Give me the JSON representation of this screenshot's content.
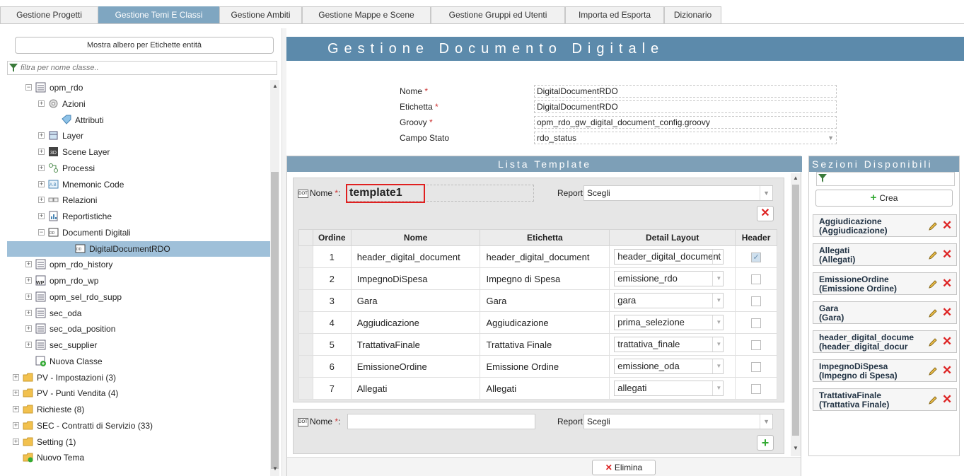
{
  "tabs": [
    {
      "label": "Gestione Progetti",
      "active": false
    },
    {
      "label": "Gestione Temi E Classi",
      "active": true
    },
    {
      "label": "Gestione Ambiti",
      "active": false
    },
    {
      "label": "Gestione Mappe e Scene",
      "active": false
    },
    {
      "label": "Gestione Gruppi ed Utenti",
      "active": false
    },
    {
      "label": "Importa ed Esporta",
      "active": false
    },
    {
      "label": "Dizionario",
      "active": false
    }
  ],
  "left": {
    "tree_button_label": "Mostra albero per Etichette entità",
    "filter_placeholder": "filtra per nome classe..",
    "tree": [
      {
        "label": "opm_rdo",
        "expander": "−"
      },
      {
        "label": "Azioni",
        "expander": "+"
      },
      {
        "label": "Attributi",
        "expander": ""
      },
      {
        "label": "Layer",
        "expander": "+"
      },
      {
        "label": "Scene Layer",
        "expander": "+"
      },
      {
        "label": "Processi",
        "expander": "+"
      },
      {
        "label": "Mnemonic Code",
        "expander": "+"
      },
      {
        "label": "Relazioni",
        "expander": "+"
      },
      {
        "label": "Reportistiche",
        "expander": "+"
      },
      {
        "label": "Documenti Digitali",
        "expander": "−"
      },
      {
        "label": "DigitalDocumentRDO",
        "expander": ""
      },
      {
        "label": "opm_rdo_history",
        "expander": "+"
      },
      {
        "label": "opm_rdo_wp",
        "expander": "+"
      },
      {
        "label": "opm_sel_rdo_supp",
        "expander": "+"
      },
      {
        "label": "sec_oda",
        "expander": "+"
      },
      {
        "label": "sec_oda_position",
        "expander": "+"
      },
      {
        "label": "sec_supplier",
        "expander": "+"
      },
      {
        "label": "Nuova Classe",
        "expander": ""
      },
      {
        "label": "PV - Impostazioni (3)",
        "expander": "+"
      },
      {
        "label": "PV - Punti Vendita (4)",
        "expander": "+"
      },
      {
        "label": "Richieste (8)",
        "expander": "+"
      },
      {
        "label": "SEC - Contratti di Servizio (33)",
        "expander": "+"
      },
      {
        "label": "Setting (1)",
        "expander": "+"
      },
      {
        "label": "Nuovo Tema",
        "expander": ""
      }
    ]
  },
  "main": {
    "title": "Gestione Documento Digitale",
    "form": {
      "nome_label": "Nome",
      "nome_value": "DigitalDocumentRDO",
      "etichetta_label": "Etichetta",
      "etichetta_value": "DigitalDocumentRDO",
      "groovy_label": "Groovy",
      "groovy_value": "opm_rdo_gw_digital_document_config.groovy",
      "campo_stato_label": "Campo Stato",
      "campo_stato_value": "rdo_status",
      "required_mark": "*"
    },
    "lista": {
      "title": "Lista Template",
      "template1": {
        "nome_label": "Nome",
        "nome_value": "template1",
        "report_label": "Report:",
        "report_value": "Scegli"
      },
      "table": {
        "headers": [
          "Ordine",
          "Nome",
          "Etichetta",
          "Detail Layout",
          "Header"
        ],
        "rows": [
          {
            "ordine": "1",
            "nome": "header_digital_document",
            "etichetta": "header_digital_document",
            "layout": "header_digital_document",
            "header": true
          },
          {
            "ordine": "2",
            "nome": "ImpegnoDiSpesa",
            "etichetta": "Impegno di Spesa",
            "layout": "emissione_rdo",
            "header": false
          },
          {
            "ordine": "3",
            "nome": "Gara",
            "etichetta": "Gara",
            "layout": "gara",
            "header": false
          },
          {
            "ordine": "4",
            "nome": "Aggiudicazione",
            "etichetta": "Aggiudicazione",
            "layout": "prima_selezione",
            "header": false
          },
          {
            "ordine": "5",
            "nome": "TrattativaFinale",
            "etichetta": "Trattativa Finale",
            "layout": "trattativa_finale",
            "header": false
          },
          {
            "ordine": "6",
            "nome": "EmissioneOrdine",
            "etichetta": "Emissione Ordine",
            "layout": "emissione_oda",
            "header": false
          },
          {
            "ordine": "7",
            "nome": "Allegati",
            "etichetta": "Allegati",
            "layout": "allegati",
            "header": false
          }
        ]
      },
      "new_template": {
        "nome_label": "Nome",
        "nome_value": "",
        "report_label": "Report:",
        "report_value": "Scegli"
      },
      "elimina_label": "Elimina"
    },
    "sezioni": {
      "title": "Sezioni Disponibili",
      "crea_label": "Crea",
      "items": [
        {
          "name": "Aggiudicazione",
          "label": "(Aggiudicazione)"
        },
        {
          "name": "Allegati",
          "label": "(Allegati)"
        },
        {
          "name": "EmissioneOrdine",
          "label": "(Emissione Ordine)"
        },
        {
          "name": "Gara",
          "label": "(Gara)"
        },
        {
          "name": "header_digital_docume",
          "label": "(header_digital_docur"
        },
        {
          "name": "ImpegnoDiSpesa",
          "label": "(Impegno di Spesa)"
        },
        {
          "name": "TrattativaFinale",
          "label": "(Trattativa Finale)"
        }
      ]
    }
  },
  "colors": {
    "accent": "#5c8aab",
    "panel_header": "#7d9fb7",
    "active_tab": "#7fa6c1",
    "delete": "#dd2222",
    "add": "#33aa33"
  }
}
